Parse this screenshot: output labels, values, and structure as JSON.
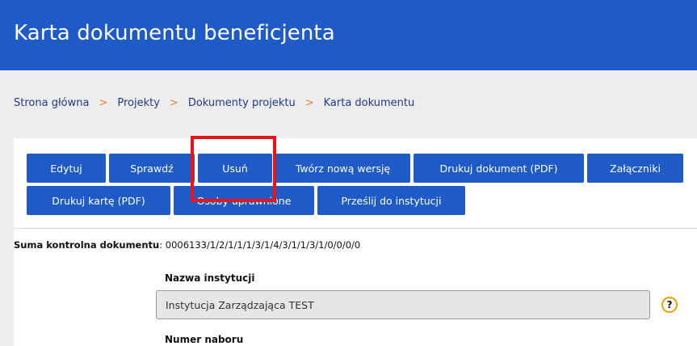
{
  "header": {
    "title": "Karta dokumentu beneficjenta"
  },
  "breadcrumb": {
    "items": [
      "Strona główna",
      "Projekty",
      "Dokumenty projektu",
      "Karta dokumentu"
    ],
    "separator": ">"
  },
  "toolbar": {
    "edit": "Edytuj",
    "check": "Sprawdź",
    "delete": "Usuń",
    "new_version": "Twórz nową wersję",
    "print_doc": "Drukuj dokument (PDF)",
    "attachments": "Załączniki",
    "print_card": "Drukuj kartę (PDF)",
    "authorized": "Osoby uprawnione",
    "send": "Prześlij do instytucji"
  },
  "checksum": {
    "label": "Suma kontrolna dokumentu",
    "value": ": 0006133/1/2/1/1/1/3/1/4/3/1/1/3/1/0/0/0/0"
  },
  "fields": {
    "institution_label": "Nazwa instytucji",
    "institution_value": "Instytucja Zarządzająca TEST",
    "call_label": "Numer naboru"
  },
  "help": {
    "glyph": "?"
  },
  "colors": {
    "primary": "#1f5bc6",
    "highlight": "#e8141b",
    "separator": "#e57f37",
    "help_ring": "#e6a400"
  }
}
